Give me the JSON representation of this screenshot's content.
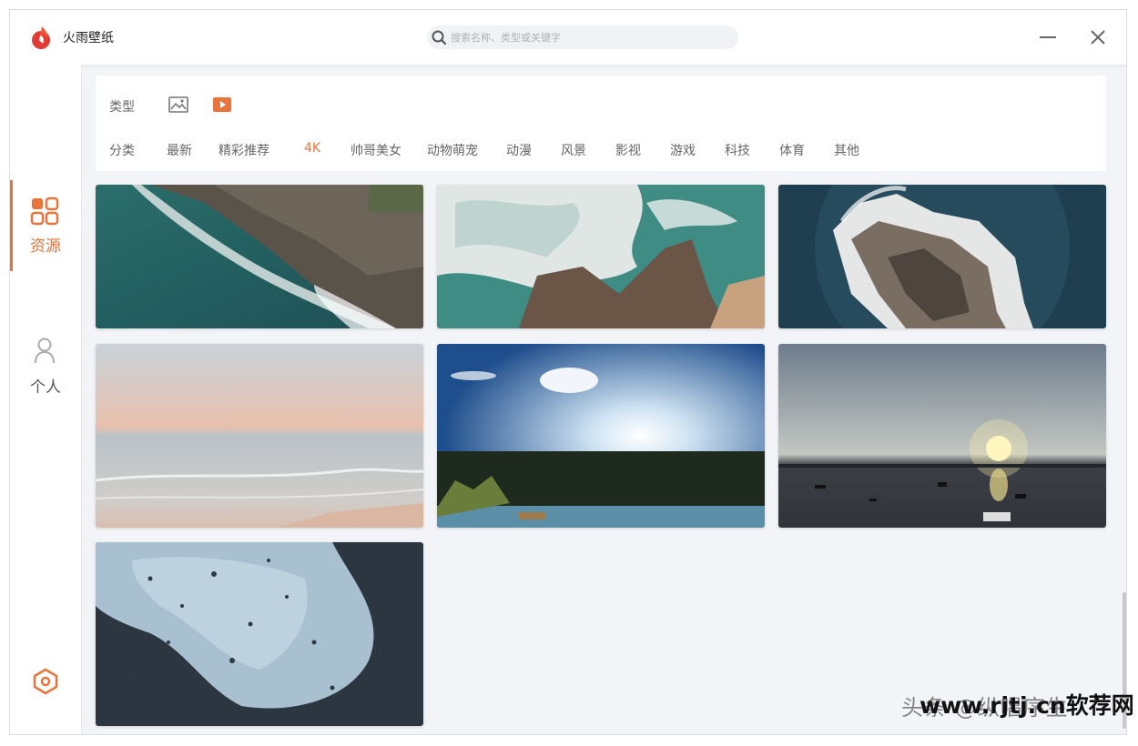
{
  "app": {
    "title": "火雨壁纸",
    "brand_color": "#e8743b"
  },
  "search": {
    "placeholder": "搜索名称、类型或关键字"
  },
  "sidebar": {
    "items": [
      {
        "label": "资源",
        "icon": "grid-icon",
        "active": true
      },
      {
        "label": "个人",
        "icon": "person-icon",
        "active": false
      }
    ],
    "settings_icon": "hexagon-settings-icon"
  },
  "filters": {
    "type_label": "类型",
    "types": [
      {
        "icon": "image-icon",
        "active": false
      },
      {
        "icon": "video-play-icon",
        "active": true
      }
    ],
    "category_label": "分类",
    "categories": [
      "最新",
      "精彩推荐",
      "4K",
      "帅哥美女",
      "动物萌宠",
      "动漫",
      "风景",
      "影视",
      "游戏",
      "科技",
      "体育",
      "其他"
    ],
    "active_category": "4K"
  },
  "wallpapers": [
    {
      "subject": "aerial-waves-rocky-shore"
    },
    {
      "subject": "aerial-surf-over-rocks"
    },
    {
      "subject": "aerial-rock-island-sea"
    },
    {
      "subject": "pastel-beach-dusk"
    },
    {
      "subject": "sun-over-lake-blue-sky"
    },
    {
      "subject": "sunset-harbor-boats"
    },
    {
      "subject": "rain-drops-on-window"
    }
  ],
  "watermark": {
    "text_back": "头条 @纵唱序生",
    "text_front": "www.rjtj.cn软荐网"
  }
}
